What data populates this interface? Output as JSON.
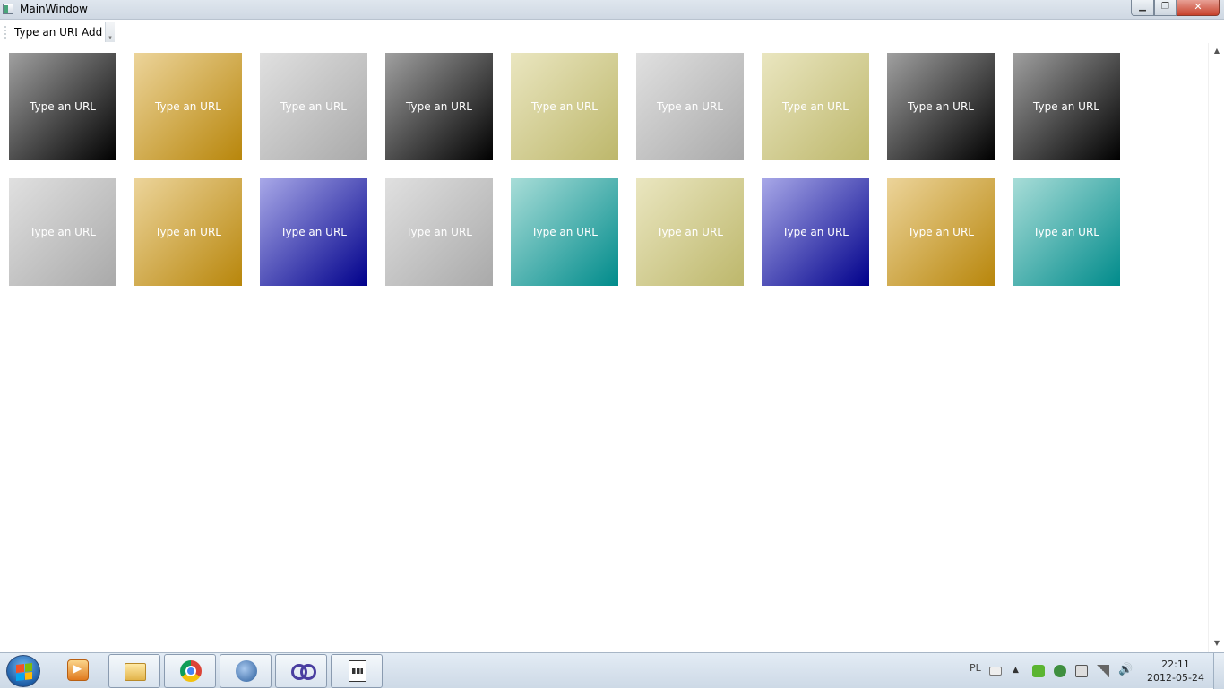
{
  "window": {
    "title": "MainWindow",
    "buttons": {
      "minimize": "▁",
      "maximize": "❐",
      "close": "✕"
    }
  },
  "toolbar": {
    "url_value": "Type an URL",
    "add_label": "Add",
    "overflow_glyph": "▾"
  },
  "tiles": {
    "rows": [
      [
        {
          "label": "Type an URL",
          "color": "gray-dark"
        },
        {
          "label": "Type an URL",
          "color": "gold"
        },
        {
          "label": "Type an URL",
          "color": "silver"
        },
        {
          "label": "Type an URL",
          "color": "gray-dark"
        },
        {
          "label": "Type an URL",
          "color": "khaki"
        },
        {
          "label": "Type an URL",
          "color": "silver"
        },
        {
          "label": "Type an URL",
          "color": "khaki"
        },
        {
          "label": "Type an URL",
          "color": "gray-dark"
        },
        {
          "label": "Type an URL",
          "color": "gray-dark"
        }
      ],
      [
        {
          "label": "Type an URL",
          "color": "silver"
        },
        {
          "label": "Type an URL",
          "color": "gold"
        },
        {
          "label": "Type an URL",
          "color": "blue"
        },
        {
          "label": "Type an URL",
          "color": "silver"
        },
        {
          "label": "Type an URL",
          "color": "teal"
        },
        {
          "label": "Type an URL",
          "color": "khaki"
        },
        {
          "label": "Type an URL",
          "color": "blue"
        },
        {
          "label": "Type an URL",
          "color": "gold"
        },
        {
          "label": "Type an URL",
          "color": "teal"
        }
      ]
    ],
    "gradients": {
      "gray-dark": [
        "#a0a0a0",
        "#000000"
      ],
      "gold": [
        "#ecd49a",
        "#b8860b"
      ],
      "silver": [
        "#e0e0e0",
        "#a9a9a9"
      ],
      "khaki": [
        "#eae6c0",
        "#bdb76b"
      ],
      "blue": [
        "#a8a8e8",
        "#00008b"
      ],
      "teal": [
        "#a8ddd8",
        "#008b8b"
      ]
    }
  },
  "scrollbar": {
    "up": "▲",
    "down": "▼"
  },
  "taskbar": {
    "apps": [
      {
        "name": "media-player",
        "active": false
      },
      {
        "name": "file-explorer",
        "active": true
      },
      {
        "name": "chrome",
        "active": true
      },
      {
        "name": "thunderbird",
        "active": true
      },
      {
        "name": "visual-studio",
        "active": true
      },
      {
        "name": "document-app",
        "active": true
      }
    ],
    "tray": {
      "language": "PL",
      "arrow": "▲",
      "volume": "🔊",
      "time": "22:11",
      "date": "2012-05-24"
    }
  }
}
